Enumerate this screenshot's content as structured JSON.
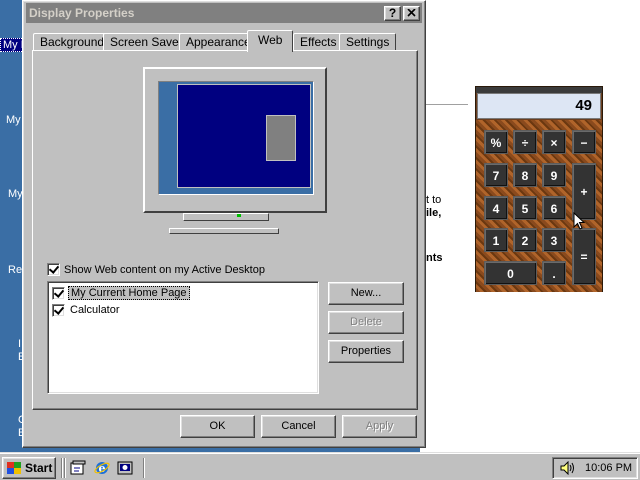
{
  "desktop": {
    "icons": [
      {
        "label": "My D",
        "selected": true
      },
      {
        "label": "My"
      },
      {
        "label": "My"
      },
      {
        "label": "Re"
      },
      {
        "label": "I"
      },
      {
        "label": "E"
      },
      {
        "label": "C"
      },
      {
        "label": "E"
      }
    ]
  },
  "background_doc": {
    "snippets": [
      "t to",
      "ile,",
      "nts"
    ]
  },
  "dialog": {
    "title": "Display Properties",
    "help_label": "?",
    "close_label": "✕",
    "tabs": [
      {
        "label": "Background"
      },
      {
        "label": "Screen Saver"
      },
      {
        "label": "Appearance"
      },
      {
        "label": "Web",
        "active": true
      },
      {
        "label": "Effects"
      },
      {
        "label": "Settings"
      }
    ],
    "show_web_label": "Show Web content on my Active Desktop",
    "show_web_checked": true,
    "items": [
      {
        "label": "My Current Home Page",
        "checked": true,
        "selected": true
      },
      {
        "label": "Calculator",
        "checked": true
      }
    ],
    "buttons": {
      "new": "New...",
      "delete": "Delete",
      "properties": "Properties",
      "ok": "OK",
      "cancel": "Cancel",
      "apply": "Apply"
    }
  },
  "calculator": {
    "display": "49",
    "keys": {
      "percent": "%",
      "divide": "÷",
      "multiply": "×",
      "minus": "−",
      "seven": "7",
      "eight": "8",
      "nine": "9",
      "plus": "+",
      "four": "4",
      "five": "5",
      "six": "6",
      "one": "1",
      "two": "2",
      "three": "3",
      "equals": "=",
      "zero": "0",
      "decimal": "."
    }
  },
  "taskbar": {
    "start_label": "Start",
    "clock": "10:06 PM",
    "quick_launch": [
      "show-desktop-icon",
      "internet-explorer-icon",
      "channels-icon"
    ]
  },
  "colors": {
    "desktop": "#3a6ea5",
    "titlebar_inactive": "#808080",
    "face": "#c0c0c0",
    "navy": "#000080"
  }
}
